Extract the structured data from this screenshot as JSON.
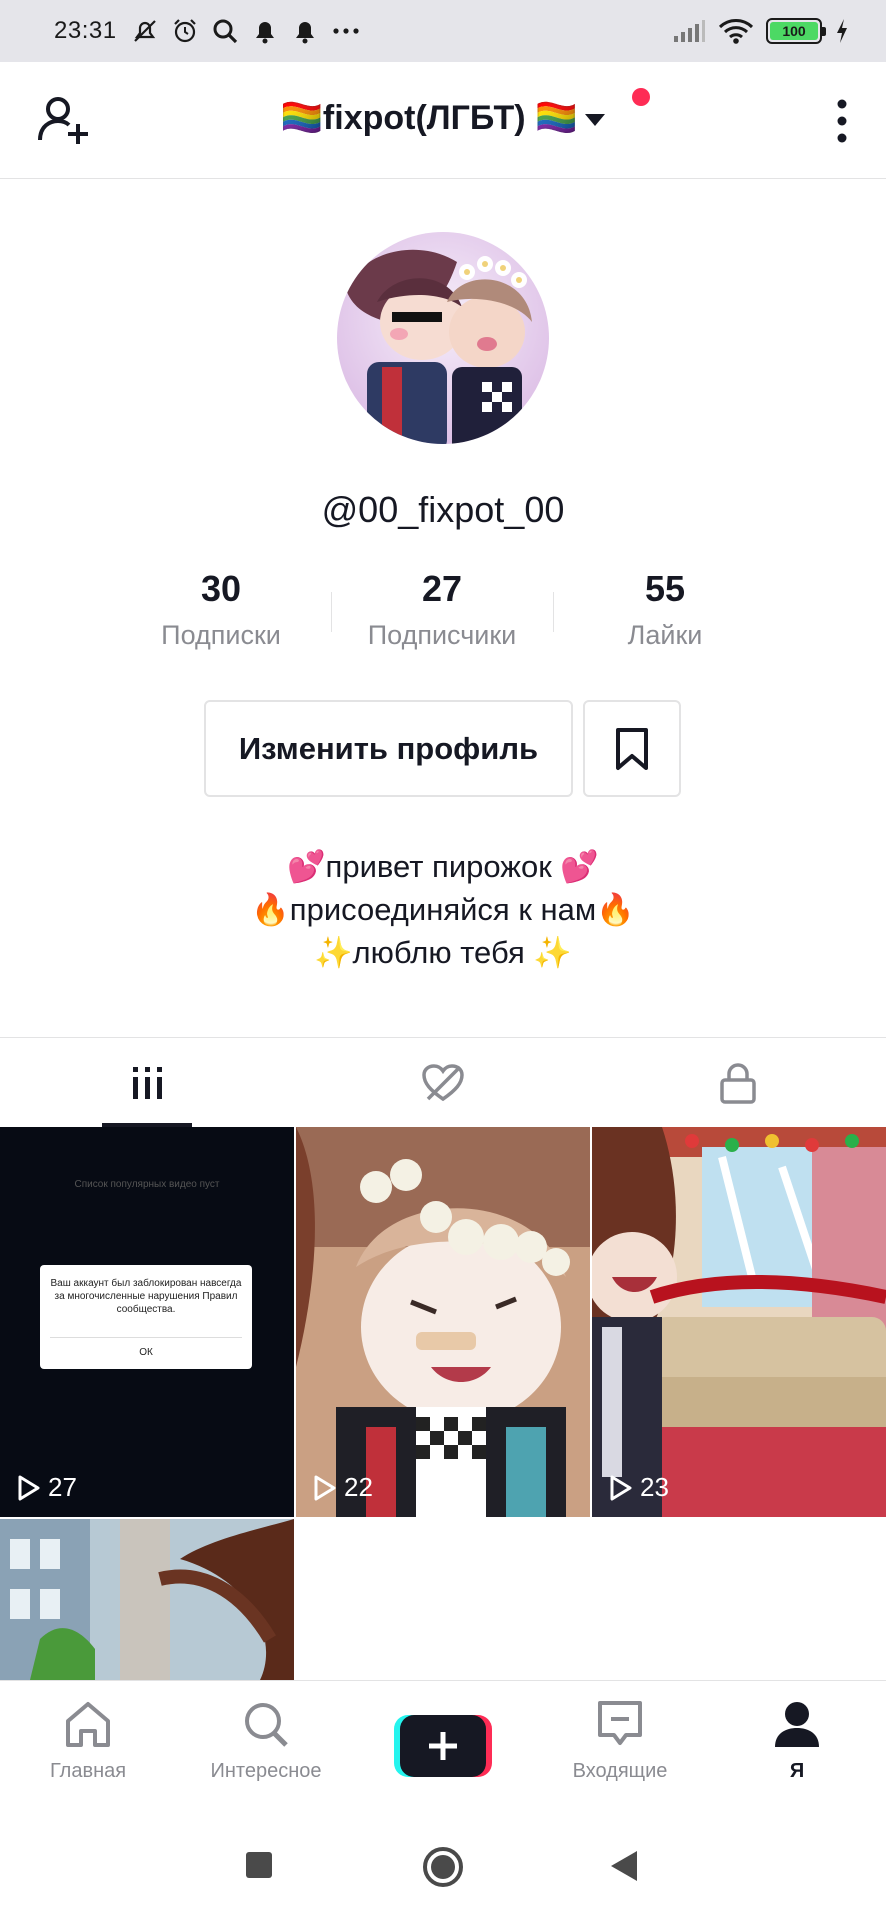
{
  "status_bar": {
    "time": "23:31",
    "battery": "100",
    "icons": [
      "mute-icon",
      "alarm-icon",
      "search-icon",
      "bell-icon",
      "bell-icon",
      "more-icon",
      "signal-icon",
      "wifi-icon",
      "battery-icon",
      "charging-icon"
    ]
  },
  "header": {
    "title": "🏳️‍🌈fixpot(ЛГБТ) 🏳️‍🌈",
    "notification_dot_color": "#fe2c55"
  },
  "profile": {
    "username": "@00_fixpot_00",
    "stats": [
      {
        "value": "30",
        "label": "Подписки"
      },
      {
        "value": "27",
        "label": "Подписчики"
      },
      {
        "value": "55",
        "label": "Лайки"
      }
    ],
    "edit_button": "Изменить профиль",
    "bio": [
      "💕привет пирожок 💕",
      "🔥присоединяйся к нам🔥",
      "✨люблю тебя ✨"
    ]
  },
  "tabs": [
    {
      "icon": "videos-grid-icon",
      "active": true
    },
    {
      "icon": "liked-hidden-icon",
      "active": false
    },
    {
      "icon": "lock-icon",
      "active": false
    }
  ],
  "videos": [
    {
      "plays": "27",
      "modal_top_text": "Список популярных видео пуст",
      "modal_text": "Ваш аккаунт был заблокирован навсегда за многочисленные нарушения Правил сообщества.",
      "modal_ok": "ОК"
    },
    {
      "plays": "22"
    },
    {
      "plays": "23"
    },
    {
      "plays": ""
    }
  ],
  "bottom_nav": [
    {
      "label": "Главная",
      "icon": "home-icon"
    },
    {
      "label": "Интересное",
      "icon": "search-icon"
    },
    {
      "label": "",
      "icon": "create-icon"
    },
    {
      "label": "Входящие",
      "icon": "inbox-icon"
    },
    {
      "label": "Я",
      "icon": "profile-icon",
      "active": true
    }
  ],
  "colors": {
    "accent": "#fe2c55",
    "cyan": "#25f4ee",
    "text": "#161823",
    "muted": "#8a8b91"
  }
}
